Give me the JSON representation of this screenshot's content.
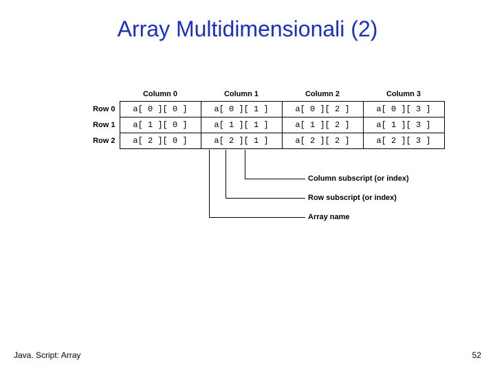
{
  "title": "Array Multidimensionali (2)",
  "cols": [
    "Column 0",
    "Column 1",
    "Column 2",
    "Column 3"
  ],
  "rows": [
    "Row 0",
    "Row 1",
    "Row 2"
  ],
  "cells": [
    [
      "a[ 0 ][ 0 ]",
      "a[ 0 ][ 1 ]",
      "a[ 0 ][ 2 ]",
      "a[ 0 ][ 3 ]"
    ],
    [
      "a[ 1 ][ 0 ]",
      "a[ 1 ][ 1 ]",
      "a[ 1 ][ 2 ]",
      "a[ 1 ][ 3 ]"
    ],
    [
      "a[ 2 ][ 0 ]",
      "a[ 2 ][ 1 ]",
      "a[ 2 ][ 2 ]",
      "a[ 2 ][ 3 ]"
    ]
  ],
  "anno": {
    "col_sub": "Column subscript (or index)",
    "row_sub": "Row subscript (or index)",
    "arr_name": "Array name"
  },
  "footer_left": "Java. Script: Array",
  "footer_right": "52"
}
